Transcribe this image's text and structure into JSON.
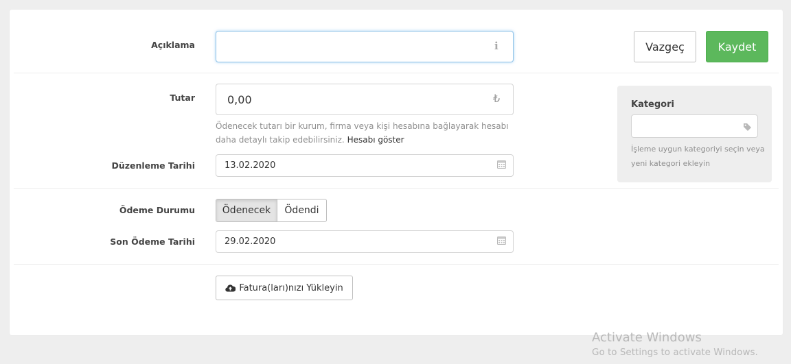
{
  "form": {
    "description": {
      "label": "Açıklama",
      "value": "",
      "icon": "info-icon"
    },
    "amount": {
      "label": "Tutar",
      "value": "0,00",
      "currency_symbol": "₺",
      "help_text": "Ödenecek tutarı bir kurum, firma veya kişi hesabına bağlayarak hesabı daha detaylı takip edebilirsiniz.",
      "help_link": "Hesabı göster"
    },
    "issue_date": {
      "label": "Düzenleme Tarihi",
      "value": "13.02.2020",
      "icon": "calendar-icon"
    },
    "payment_status": {
      "label": "Ödeme Durumu",
      "options": [
        "Ödenecek",
        "Ödendi"
      ],
      "selected": "Ödenecek"
    },
    "due_date": {
      "label": "Son Ödeme Tarihi",
      "value": "29.02.2020",
      "icon": "calendar-icon"
    },
    "upload": {
      "label": "Fatura(ları)nızı Yükleyin",
      "icon": "cloud-upload-icon"
    }
  },
  "actions": {
    "cancel_label": "Vazgeç",
    "save_label": "Kaydet"
  },
  "category": {
    "title": "Kategori",
    "value": "",
    "icon": "tag-icon",
    "help": "İşleme uygun kategoriyi seçin veya yeni kategori ekleyin"
  },
  "watermark": {
    "title": "Activate Windows",
    "subtitle": "Go to Settings to activate Windows."
  },
  "colors": {
    "save_button": "#5cb85c",
    "focus_border": "#66afe9",
    "page_bg": "#eeeeee"
  }
}
